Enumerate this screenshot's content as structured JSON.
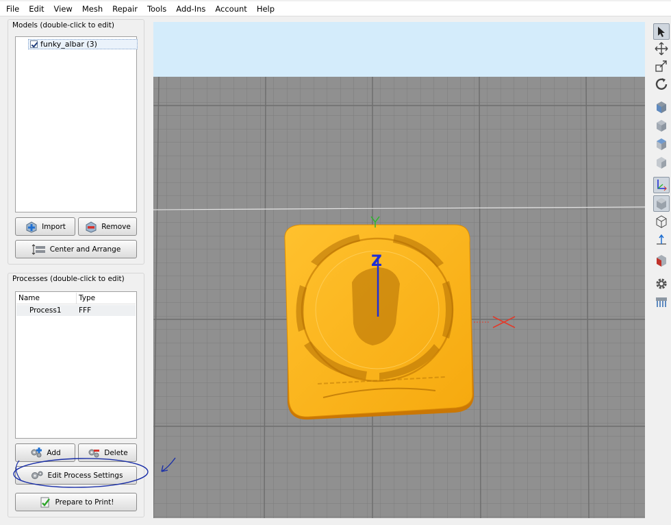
{
  "menu": [
    "File",
    "Edit",
    "View",
    "Mesh",
    "Repair",
    "Tools",
    "Add-Ins",
    "Account",
    "Help"
  ],
  "models": {
    "title": "Models (double-click to edit)",
    "items": [
      {
        "label": "funky_albar (3)",
        "checked": true
      }
    ],
    "import_label": "Import",
    "remove_label": "Remove",
    "center_label": "Center and Arrange"
  },
  "processes": {
    "title": "Processes (double-click to edit)",
    "columns": [
      "Name",
      "Type"
    ],
    "rows": [
      {
        "name": "Process1",
        "type": "FFF"
      }
    ],
    "add_label": "Add",
    "delete_label": "Delete",
    "edit_label": "Edit Process Settings",
    "prepare_label": "Prepare to Print!"
  },
  "viewport": {
    "axis_labels": {
      "y": "Y",
      "z": "Z"
    },
    "model_color": "#ffb319",
    "sky_color": "#d4ecfb",
    "bed_color": "#909090",
    "annotation_color": "#1a2fa8"
  },
  "toolbar": {
    "tools": [
      "select-icon",
      "move-icon",
      "scale-icon",
      "rotate-icon",
      "view-front-icon",
      "view-side-icon",
      "view-top-icon",
      "view-iso-icon",
      "axes-toggle-icon",
      "solid-view-icon",
      "wireframe-view-icon",
      "normals-icon",
      "cross-section-icon",
      "settings-gear-icon",
      "support-icon"
    ]
  }
}
